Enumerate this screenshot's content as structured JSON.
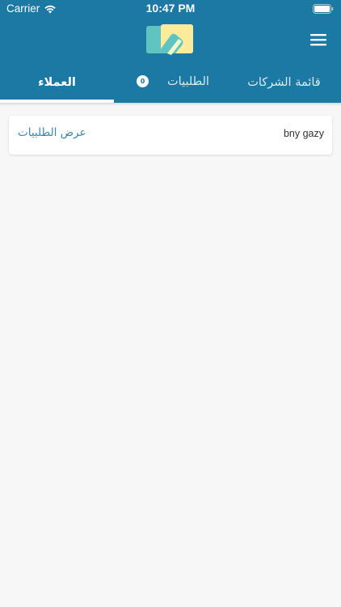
{
  "status_bar": {
    "carrier": "Carrier",
    "time": "10:47 PM"
  },
  "header": {
    "logo_icon": "app-logo-icon",
    "menu_icon": "hamburger-menu-icon",
    "colors": {
      "primary": "#1c79a4",
      "logo_teal": "#5fc4c1",
      "logo_yellow": "#fbeb9a"
    }
  },
  "tabs": {
    "customers": "العملاء",
    "orders": "الطلبيات",
    "orders_badge": "0",
    "companies": "قائمة الشركات",
    "active": "customers"
  },
  "list": {
    "items": [
      {
        "name": "bny gazy",
        "action": "عرض الطلبيات"
      }
    ]
  }
}
